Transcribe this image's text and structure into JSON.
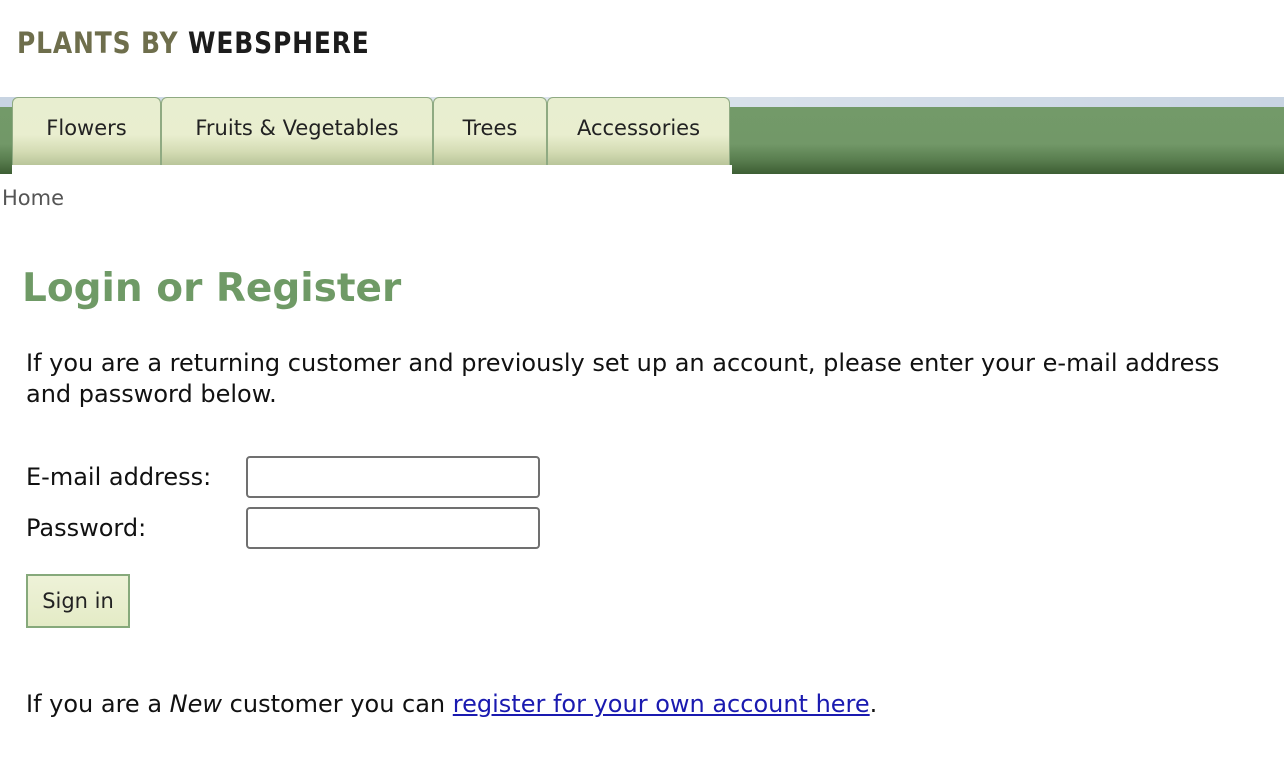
{
  "logo": {
    "part1": "PLANTS BY",
    "part2": "WEBSPHERE"
  },
  "nav": {
    "tabs": [
      {
        "label": "Flowers"
      },
      {
        "label": "Fruits & Vegetables"
      },
      {
        "label": "Trees"
      },
      {
        "label": "Accessories"
      }
    ]
  },
  "breadcrumb": {
    "home": "Home"
  },
  "main": {
    "title": "Login or Register",
    "intro": "If you are a returning customer and previously set up an account, please enter your e-mail address and password below.",
    "form": {
      "email_label": "E-mail address:",
      "email_value": "",
      "password_label": "Password:",
      "password_value": "",
      "signin_label": "Sign in"
    },
    "register": {
      "prefix": "If you are a ",
      "emphasis": "New",
      "middle": " customer you can ",
      "link_text": "register for your own account here",
      "suffix": "."
    }
  },
  "colors": {
    "title_green": "#6f9a66",
    "nav_green": "#729868",
    "tab_bg": "#e8eed0",
    "link_blue": "#1a1ab0"
  }
}
